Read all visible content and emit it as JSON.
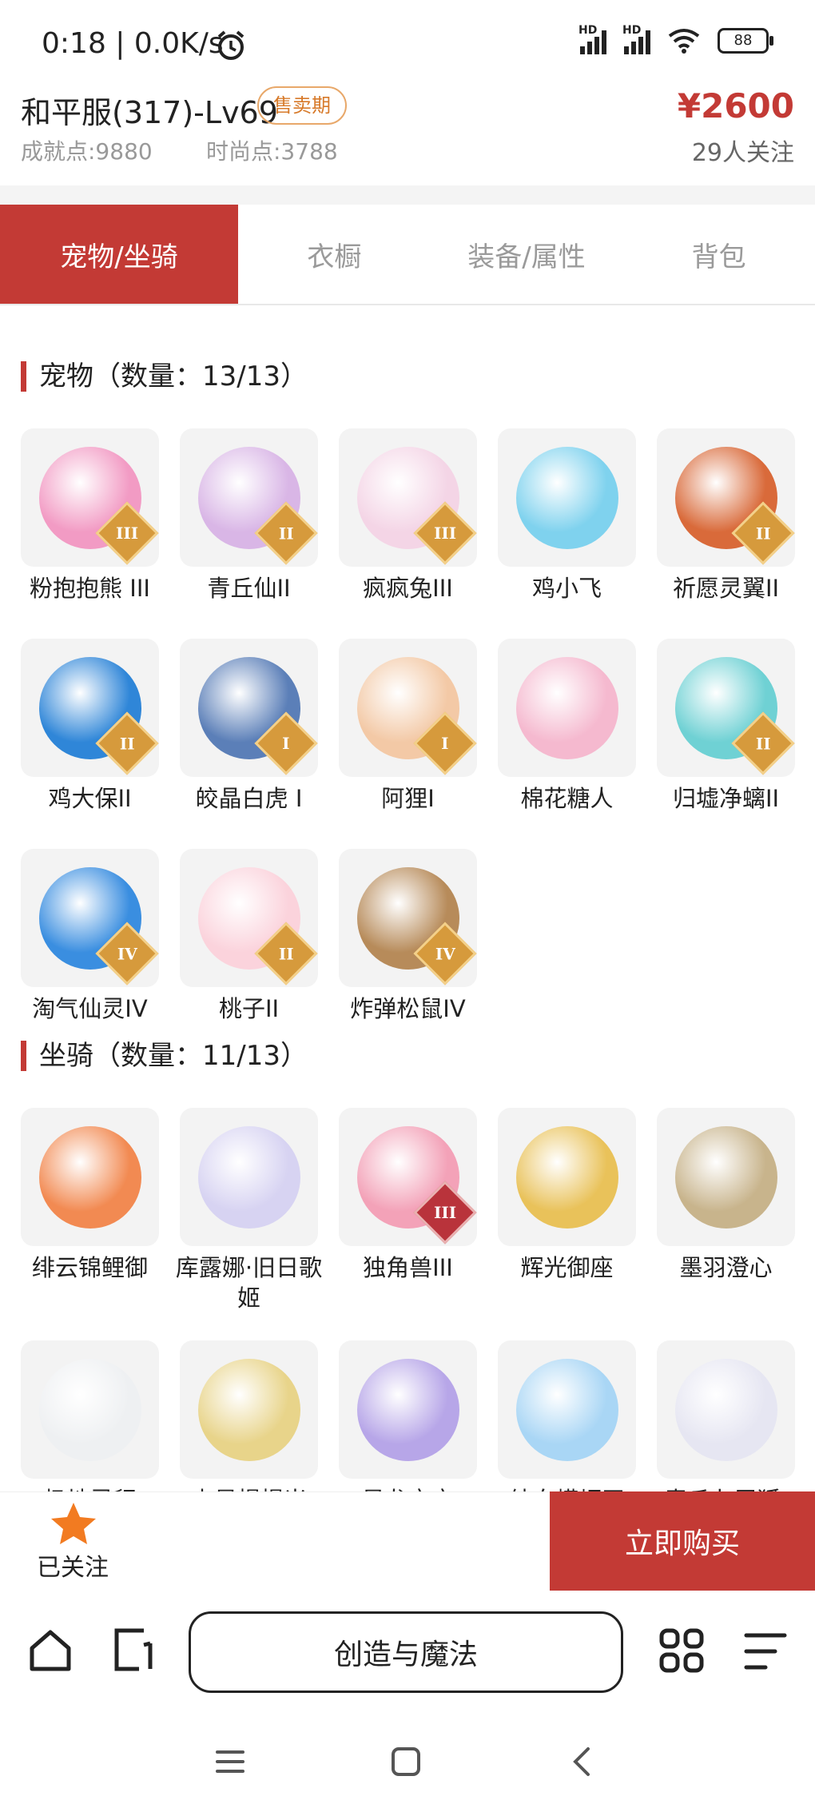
{
  "status_bar": {
    "time": "0:18",
    "network_speed": "0.0K/s",
    "battery": "88",
    "hd_label": "HD",
    "icons": [
      "alarm-icon",
      "signal-icon",
      "signal-icon",
      "wifi-icon",
      "battery-icon"
    ]
  },
  "header": {
    "title": "和平服(317)-Lv69",
    "badge": "售卖期",
    "achievement": "成就点:9880",
    "fashion": "时尚点:3788",
    "price": "¥2600",
    "followers": "29人关注"
  },
  "tabs": [
    {
      "label": "宠物/坐骑",
      "active": true
    },
    {
      "label": "衣橱",
      "active": false
    },
    {
      "label": "装备/属性",
      "active": false
    },
    {
      "label": "背包",
      "active": false
    }
  ],
  "pets": {
    "title": "宠物（数量：13/13）",
    "items": [
      {
        "name": "粉抱抱熊 III",
        "tier": "III",
        "color": "#f29bc4"
      },
      {
        "name": "青丘仙II",
        "tier": "II",
        "color": "#d9b6e6"
      },
      {
        "name": "疯疯兔III",
        "tier": "III",
        "color": "#f4d5e6"
      },
      {
        "name": "鸡小飞",
        "tier": "",
        "color": "#7fd2ee"
      },
      {
        "name": "祈愿灵翼II",
        "tier": "II",
        "color": "#d96a3a"
      },
      {
        "name": "鸡大保II",
        "tier": "II",
        "color": "#2f86d8"
      },
      {
        "name": "皎晶白虎 I",
        "tier": "I",
        "color": "#5b7fb8"
      },
      {
        "name": "阿狸I",
        "tier": "I",
        "color": "#f3c9a6"
      },
      {
        "name": "棉花糖人",
        "tier": "",
        "color": "#f5b9cf"
      },
      {
        "name": "归墟净螭II",
        "tier": "II",
        "color": "#6fd1d4"
      },
      {
        "name": "淘气仙灵IV",
        "tier": "IV",
        "color": "#3a8ee0"
      },
      {
        "name": "桃子II",
        "tier": "II",
        "color": "#fbd3dc"
      },
      {
        "name": "炸弹松鼠IV",
        "tier": "IV",
        "color": "#b78b5a"
      }
    ]
  },
  "mounts": {
    "title": "坐骑（数量：11/13）",
    "items": [
      {
        "name": "绯云锦鲤御",
        "tier": "",
        "color": "#f28a52"
      },
      {
        "name": "库露娜·旧日歌姬",
        "tier": "",
        "color": "#d7d3f2"
      },
      {
        "name": "独角兽III",
        "tier": "III",
        "color": "#f3a2b8",
        "tier_style": "red"
      },
      {
        "name": "辉光御座",
        "tier": "",
        "color": "#e9c25a"
      },
      {
        "name": "墨羽澄心",
        "tier": "",
        "color": "#c8b48c"
      },
      {
        "name": "极地灵貂",
        "tier": "",
        "color": "#eef0f2"
      },
      {
        "name": "占星榻榻米",
        "tier": "",
        "color": "#e8d48a"
      },
      {
        "name": "星龙宝宝",
        "tier": "",
        "color": "#b7a6e8"
      },
      {
        "name": "纯白蝾螈王",
        "tier": "",
        "color": "#a9d6f5"
      },
      {
        "name": "青丘九尾狐·",
        "tier": "",
        "color": "#e6e6f2"
      }
    ]
  },
  "action_bar": {
    "followed_label": "已关注",
    "buy_label": "立即购买"
  },
  "browser": {
    "address_text": "创造与魔法"
  },
  "colors": {
    "accent": "#c33a35",
    "badge_border": "#e8a86a",
    "star": "#f27b21"
  }
}
